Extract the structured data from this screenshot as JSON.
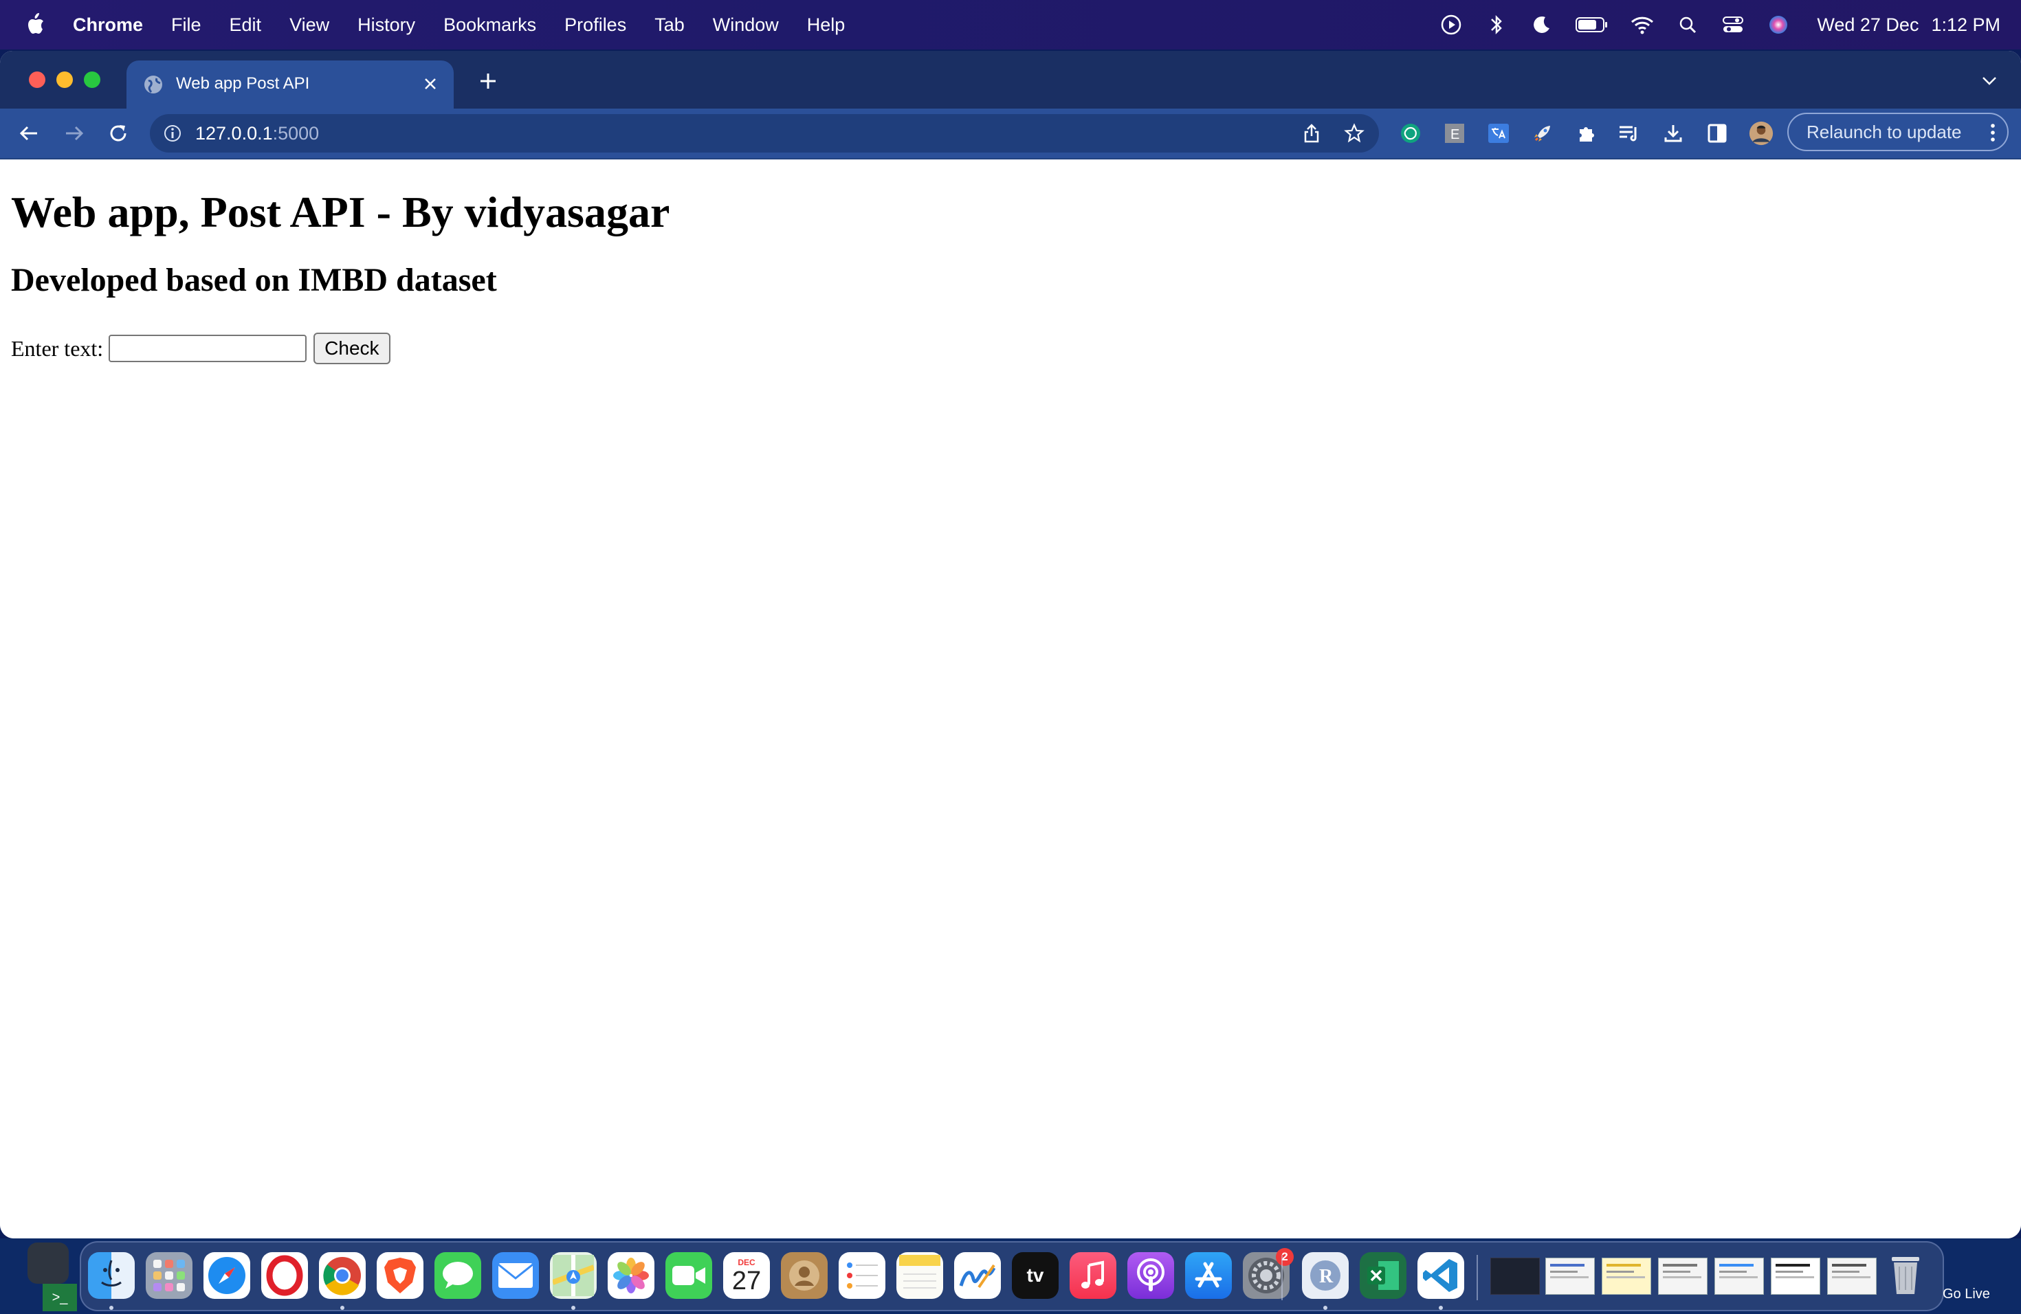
{
  "menubar": {
    "app": "Chrome",
    "items": [
      "File",
      "Edit",
      "View",
      "History",
      "Bookmarks",
      "Profiles",
      "Tab",
      "Window",
      "Help"
    ],
    "status_icons": [
      "media-play-icon",
      "bluetooth-icon",
      "moon-icon",
      "battery-icon",
      "wifi-icon",
      "spotlight-search-icon",
      "control-center-icon",
      "siri-icon"
    ],
    "date": "Wed 27 Dec",
    "time": "1:12 PM"
  },
  "browser": {
    "tab_title": "Web app Post API",
    "url_host": "127.0.0.1",
    "url_port": ":5000",
    "relaunch_label": "Relaunch to update",
    "extensions": [
      "chatgpt-icon",
      "e-extension-icon",
      "translate-extension-icon",
      "rocket-extension-icon",
      "puzzle-extensions-icon",
      "reading-list-icon",
      "download-icon",
      "side-panel-icon",
      "profile-avatar-icon"
    ]
  },
  "page": {
    "heading": "Web app, Post API - By vidyasagar",
    "subheading": "Developed based on IMBD dataset",
    "input_label": "Enter text:",
    "input_value": "",
    "button_label": "Check"
  },
  "dock": {
    "calendar_month": "DEC",
    "calendar_day": "27",
    "settings_badge": "2",
    "appletv_label": "tv",
    "go_live": "Go Live"
  },
  "colors": {
    "menubar": "#241a6e",
    "tabstrip": "#1a2f63",
    "toolbar": "#2b5099",
    "omnibox": "#1f3e7c"
  }
}
